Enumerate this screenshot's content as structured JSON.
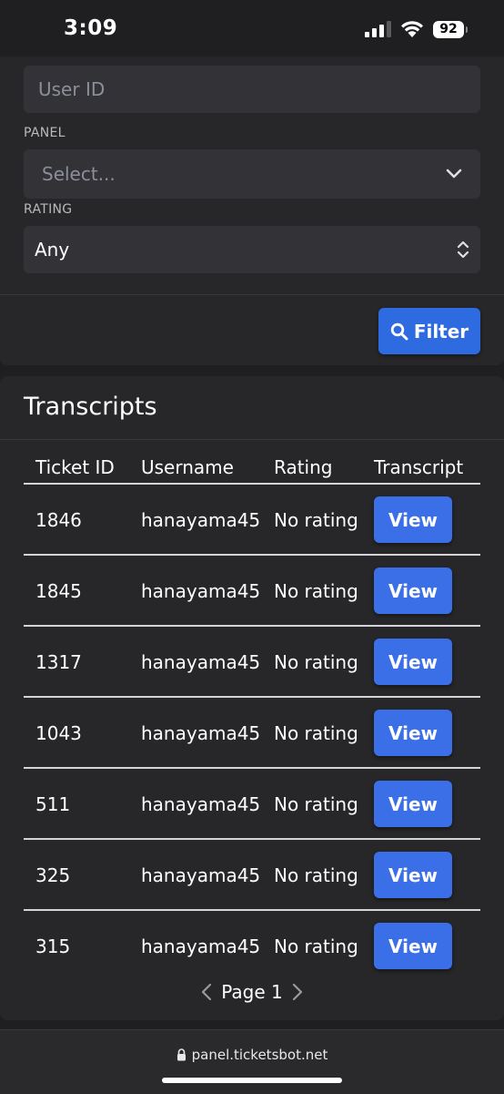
{
  "status_bar": {
    "time": "3:09",
    "battery": "92",
    "icons": [
      "signal-icon",
      "wifi-icon",
      "battery-icon"
    ]
  },
  "filters": {
    "user_id": {
      "placeholder": "User ID",
      "value": ""
    },
    "panel": {
      "label": "PANEL",
      "placeholder": "Select..."
    },
    "rating": {
      "label": "RATING",
      "value": "Any"
    },
    "filter_button": {
      "label": "Filter",
      "icon": "search-icon"
    }
  },
  "transcripts": {
    "title": "Transcripts",
    "columns": [
      "Ticket ID",
      "Username",
      "Rating",
      "Transcript"
    ],
    "rows": [
      {
        "ticket_id": "1846",
        "username": "hanayama45",
        "rating": "No rating",
        "action": "View"
      },
      {
        "ticket_id": "1845",
        "username": "hanayama45",
        "rating": "No rating",
        "action": "View"
      },
      {
        "ticket_id": "1317",
        "username": "hanayama45",
        "rating": "No rating",
        "action": "View"
      },
      {
        "ticket_id": "1043",
        "username": "hanayama45",
        "rating": "No rating",
        "action": "View"
      },
      {
        "ticket_id": "511",
        "username": "hanayama45",
        "rating": "No rating",
        "action": "View"
      },
      {
        "ticket_id": "325",
        "username": "hanayama45",
        "rating": "No rating",
        "action": "View"
      },
      {
        "ticket_id": "315",
        "username": "hanayama45",
        "rating": "No rating",
        "action": "View"
      }
    ],
    "pagination": {
      "label": "Page 1"
    }
  },
  "browser": {
    "url": "panel.ticketsbot.net"
  },
  "colors": {
    "background": "#1f1f21",
    "card": "#272729",
    "input": "#333337",
    "accent": "#3b6fe8"
  }
}
